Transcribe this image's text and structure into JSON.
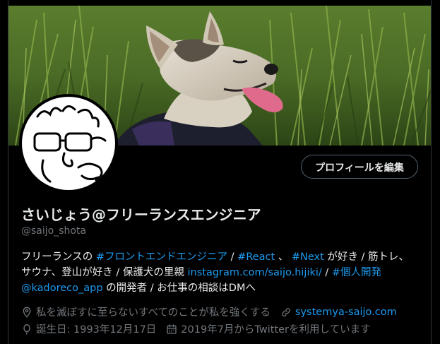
{
  "profile": {
    "display_name": "さいじょう@フリーランスエンジニア",
    "handle": "@saijo_shota",
    "edit_button": "プロフィールを編集",
    "bio": {
      "line1": {
        "t1": "フリーランスの ",
        "tag1": "#フロントエンドエンジニア",
        "t2": " / ",
        "tag2": "#React",
        "t3": " 、 ",
        "tag3": "#Next",
        "t4": " が好き /  筋トレ、"
      },
      "line2": {
        "t1": "サウナ、登山が好き / 保護犬の里親 ",
        "link1": "instagram.com/saijo.hijiki/",
        "t2": " / ",
        "tag4": "#個人開発"
      },
      "line3": {
        "mention": "@kadoreco_app",
        "t1": " の開発者 / お仕事の相談はDMへ"
      }
    },
    "location": "私を滅ぼすに至らないすべてのことが私を強くする",
    "website": "systemya-saijo.com",
    "birthday": "誕生日: 1993年12月17日",
    "joined": "2019年7月からTwitterを利用しています"
  },
  "icons": {
    "location": "location-pin-icon",
    "website": "link-icon",
    "birthday": "balloon-icon",
    "joined": "calendar-icon"
  },
  "colors": {
    "background": "#000000",
    "text_primary": "#e7e9ea",
    "text_secondary": "#71767b",
    "link": "#1d9bf0",
    "border": "#536471"
  }
}
